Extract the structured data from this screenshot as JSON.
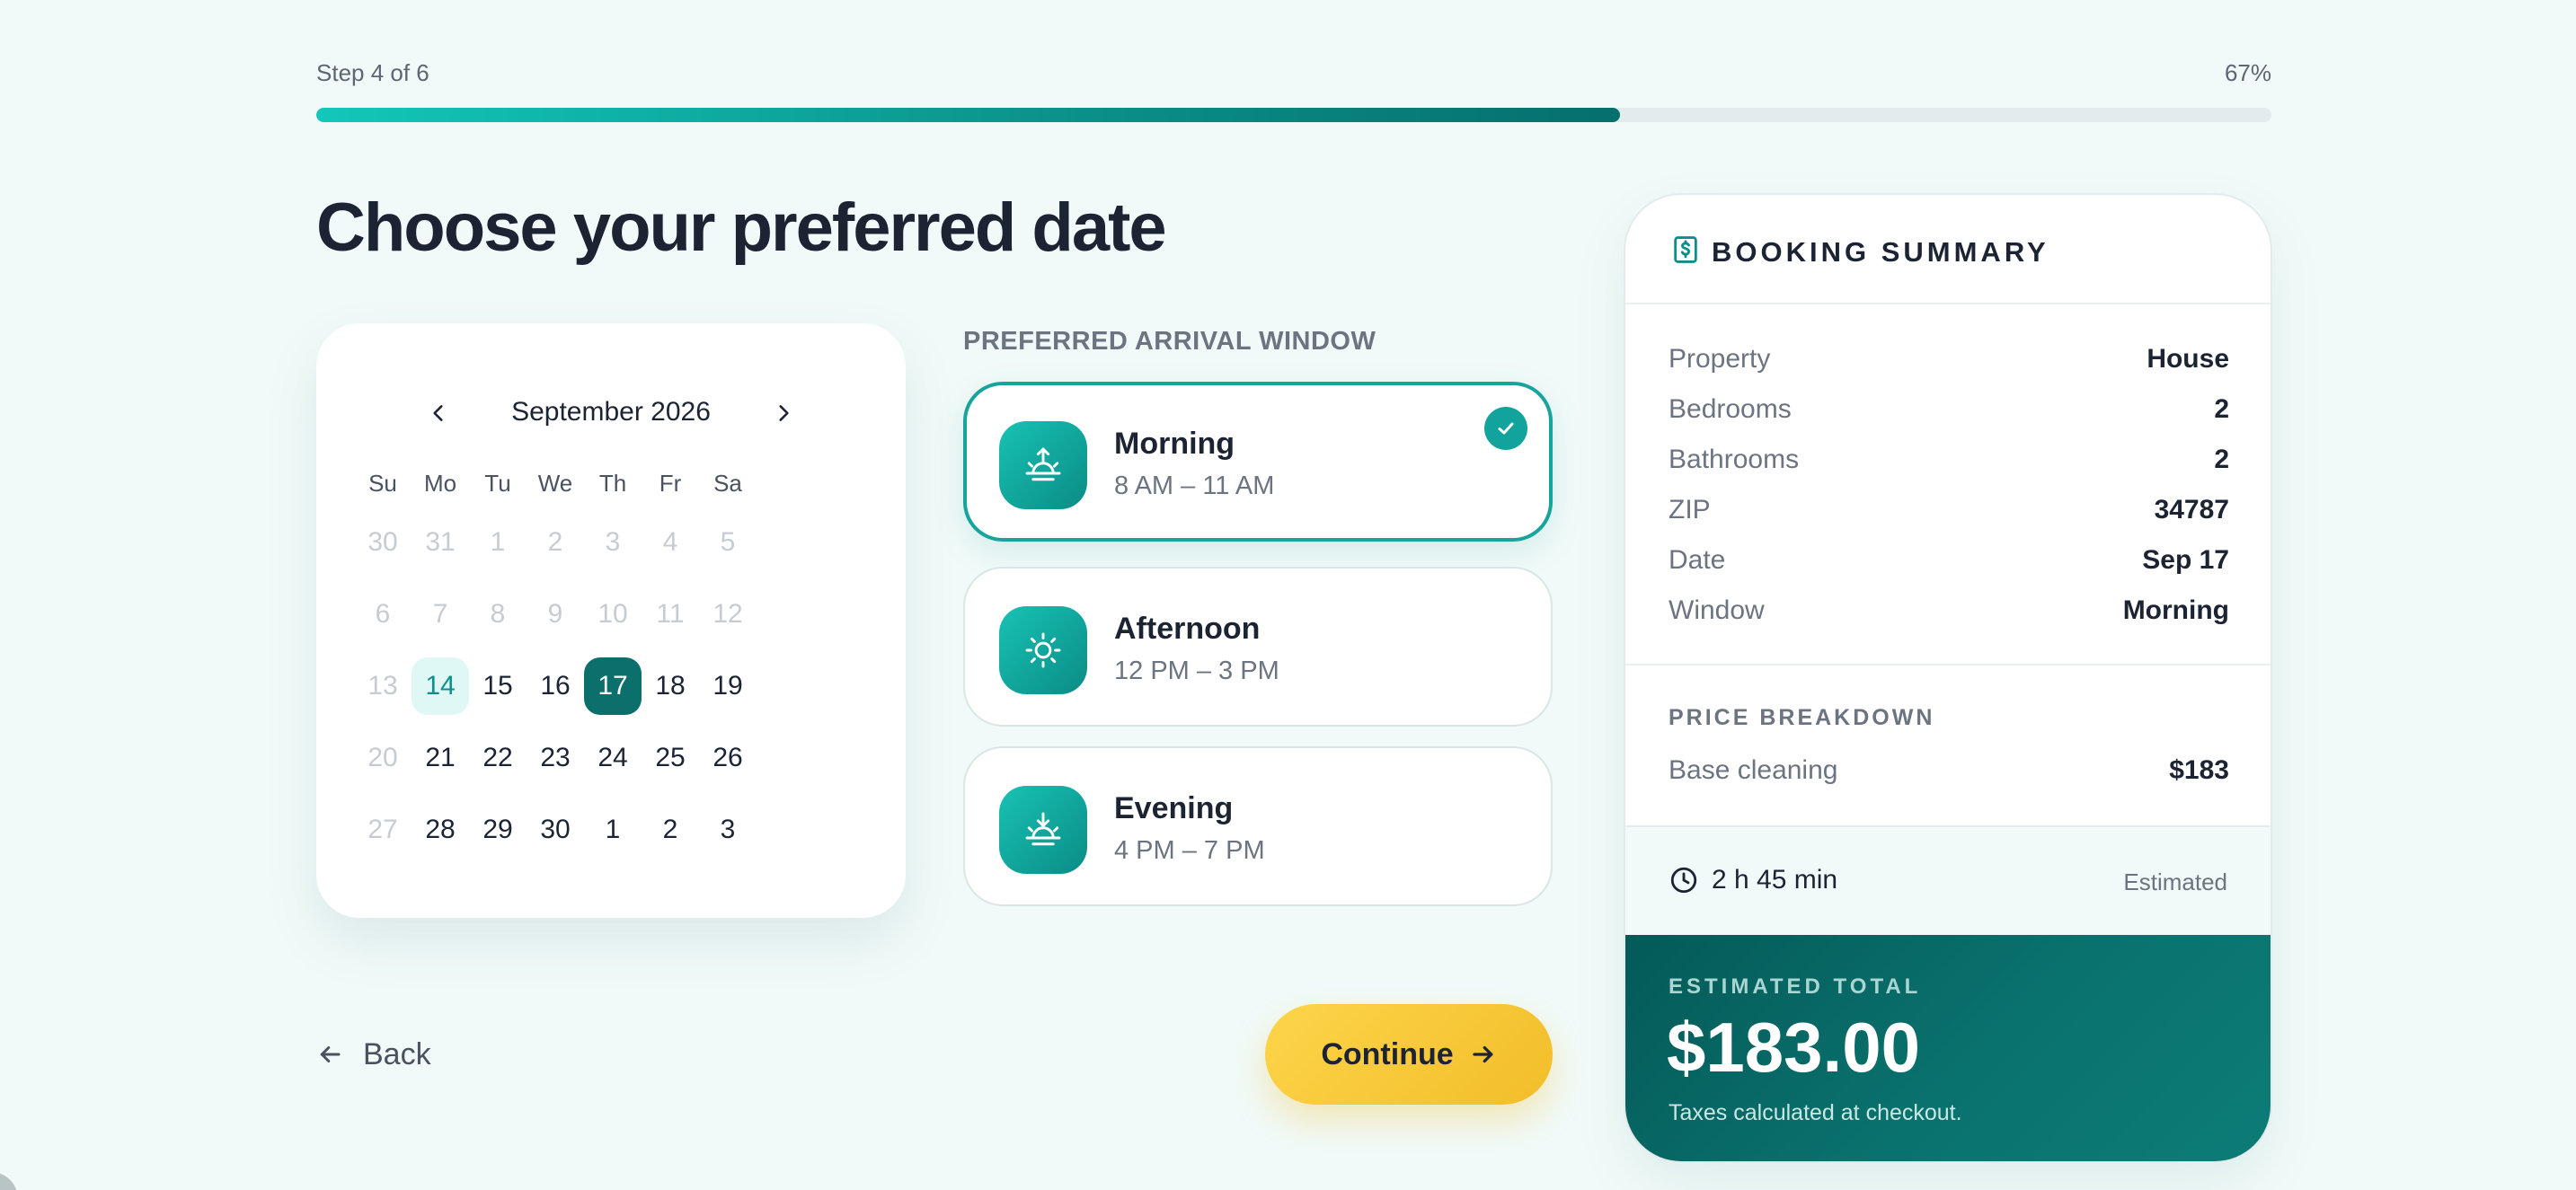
{
  "progress": {
    "step_label": "Step 4 of 6",
    "percent_label": "67%",
    "percent": 0.667
  },
  "page_title": "Choose your preferred date",
  "calendar": {
    "month_label": "September 2026",
    "weekdays": [
      "Su",
      "Mo",
      "Tu",
      "We",
      "Th",
      "Fr",
      "Sa"
    ],
    "weeks": [
      [
        "30",
        "31",
        "1",
        "2",
        "3",
        "4",
        "5"
      ],
      [
        "6",
        "7",
        "8",
        "9",
        "10",
        "11",
        "12"
      ],
      [
        "13",
        "14",
        "15",
        "16",
        "17",
        "18",
        "19"
      ],
      [
        "20",
        "21",
        "22",
        "23",
        "24",
        "25",
        "26"
      ],
      [
        "27",
        "28",
        "29",
        "30",
        "1",
        "2",
        "3"
      ]
    ],
    "states": [
      [
        "muted",
        "muted",
        "muted",
        "muted",
        "muted",
        "muted",
        "muted"
      ],
      [
        "muted",
        "muted",
        "muted",
        "muted",
        "muted",
        "muted",
        "muted"
      ],
      [
        "muted",
        "today",
        "",
        "",
        "selected",
        "",
        ""
      ],
      [
        "muted",
        "",
        "",
        "",
        "",
        "",
        ""
      ],
      [
        "muted",
        "",
        "",
        "",
        "",
        "",
        ""
      ]
    ]
  },
  "arrival": {
    "section_label": "PREFERRED ARRIVAL WINDOW",
    "windows": [
      {
        "name": "Morning",
        "time": "8 AM – 11 AM",
        "icon": "sunrise-icon",
        "selected": true
      },
      {
        "name": "Afternoon",
        "time": "12 PM – 3 PM",
        "icon": "sun-icon",
        "selected": false
      },
      {
        "name": "Evening",
        "time": "4 PM – 7 PM",
        "icon": "sunset-icon",
        "selected": false
      }
    ]
  },
  "nav": {
    "back_label": "Back",
    "continue_label": "Continue"
  },
  "summary": {
    "title": "BOOKING SUMMARY",
    "rows": [
      {
        "label": "Property",
        "value": "House"
      },
      {
        "label": "Bedrooms",
        "value": "2"
      },
      {
        "label": "Bathrooms",
        "value": "2"
      },
      {
        "label": "ZIP",
        "value": "34787"
      },
      {
        "label": "Date",
        "value": "Sep 17"
      },
      {
        "label": "Window",
        "value": "Morning"
      }
    ],
    "price_breakdown_label": "PRICE BREAKDOWN",
    "price_rows": [
      {
        "label": "Base cleaning",
        "value": "$183"
      }
    ],
    "duration": "2 h 45 min",
    "duration_note": "Estimated",
    "total_label": "ESTIMATED TOTAL",
    "total_amount": "$183.00",
    "total_note": "Taxes calculated at checkout."
  },
  "colors": {
    "accent": "#12a49c",
    "accent_dark": "#0b6f6c",
    "cta": "#f6c73a",
    "background": "#f1faf9"
  }
}
